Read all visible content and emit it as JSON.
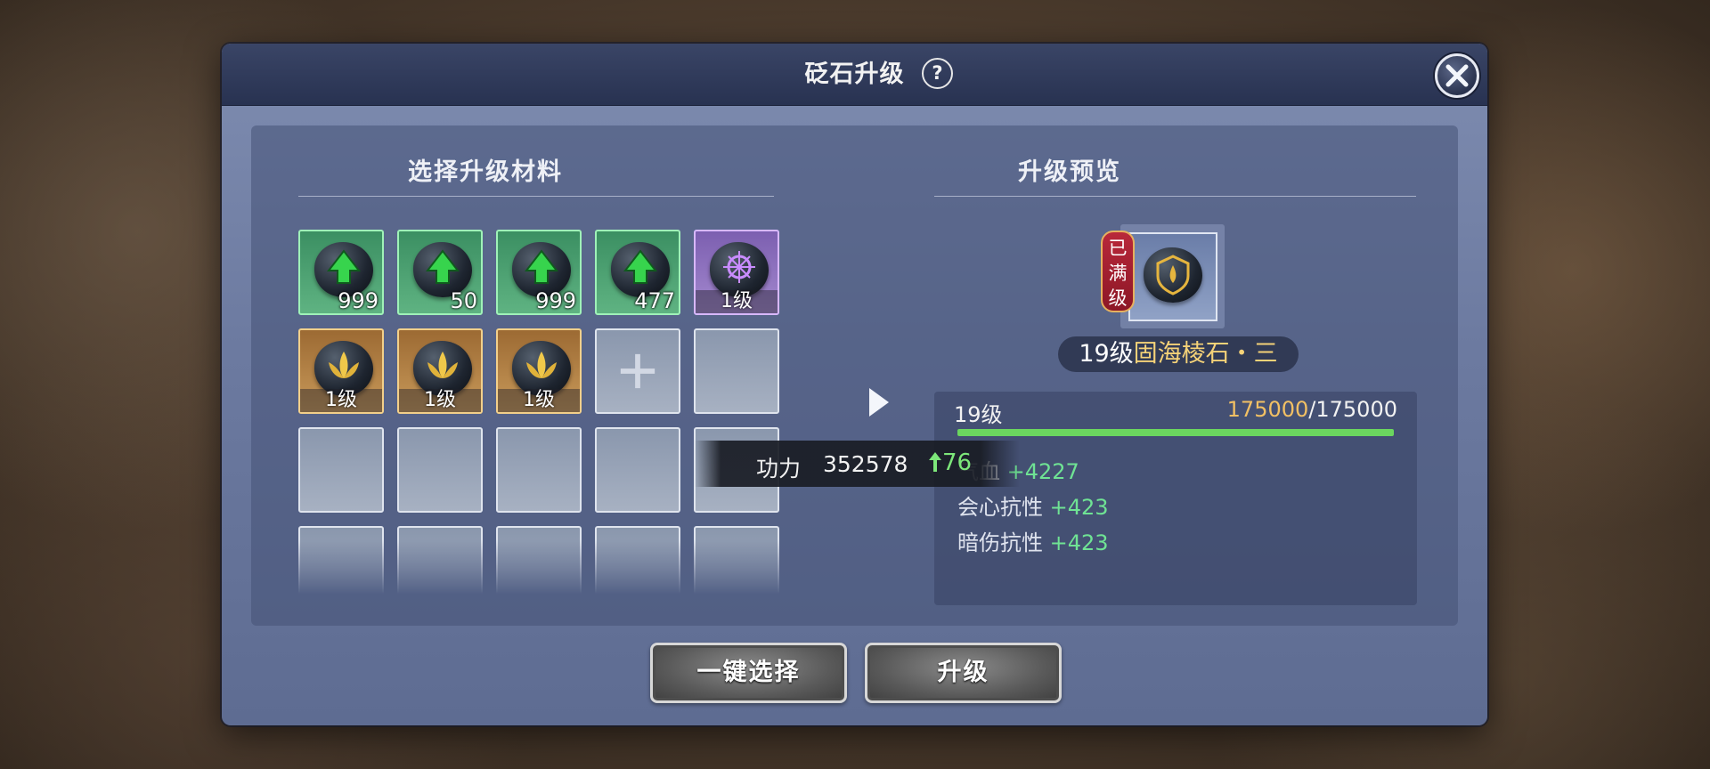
{
  "dialog": {
    "title": "砭石升级",
    "help_symbol": "?"
  },
  "materials": {
    "title": "选择升级材料",
    "slots": [
      {
        "kind": "green",
        "count": "999"
      },
      {
        "kind": "green",
        "count": "50"
      },
      {
        "kind": "green",
        "count": "999"
      },
      {
        "kind": "green",
        "count": "477"
      },
      {
        "kind": "purple",
        "level": "1级"
      },
      {
        "kind": "gold",
        "level": "1级"
      },
      {
        "kind": "gold",
        "level": "1级"
      },
      {
        "kind": "gold",
        "level": "1级"
      }
    ]
  },
  "preview": {
    "title": "升级预览",
    "maxed_badge": "已满级",
    "item_level": "19级",
    "item_name": "固海棱石・三",
    "level_label": "19级",
    "exp_current": "175000",
    "exp_separator": "/",
    "exp_max": "175000",
    "exp_fraction": 1.0,
    "stats": [
      {
        "name": "气血",
        "value": "+4227"
      },
      {
        "name": "会心抗性",
        "value": "+423"
      },
      {
        "name": "暗伤抗性",
        "value": "+423"
      }
    ]
  },
  "power": {
    "label": "功力",
    "value": "352578",
    "increase": "76"
  },
  "buttons": {
    "auto_select": "一键选择",
    "upgrade": "升级"
  },
  "colors": {
    "stat_value": "#6fe394",
    "exp_current": "#f2c064",
    "exp_bar": "#6bd65f",
    "name_gold": "#f5d278"
  }
}
